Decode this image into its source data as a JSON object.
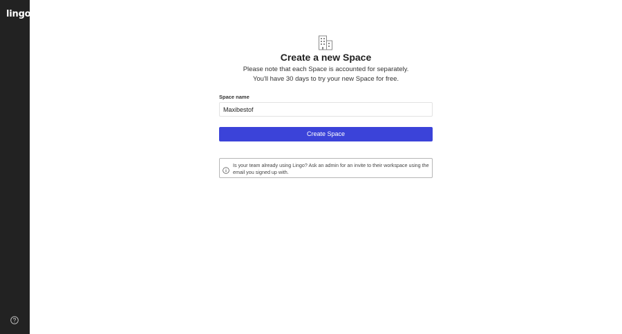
{
  "app": {
    "logo_text": "lingo"
  },
  "page": {
    "title": "Create a new Space",
    "subtitle_line1": "Please note that each Space is accounted for separately.",
    "subtitle_line2": "You'll have 30 days to try your new Space for free."
  },
  "form": {
    "space_name_label": "Space name",
    "space_name_value": "Maxibestof",
    "create_button_label": "Create Space"
  },
  "info": {
    "text": "Is your team already using Lingo? Ask an admin for an invite to their workspace using the email you signed up with."
  },
  "icons": {
    "help": "help-icon",
    "building": "building-icon",
    "info": "info-icon"
  },
  "colors": {
    "sidebar": "#222222",
    "accent": "#3b43d9"
  }
}
